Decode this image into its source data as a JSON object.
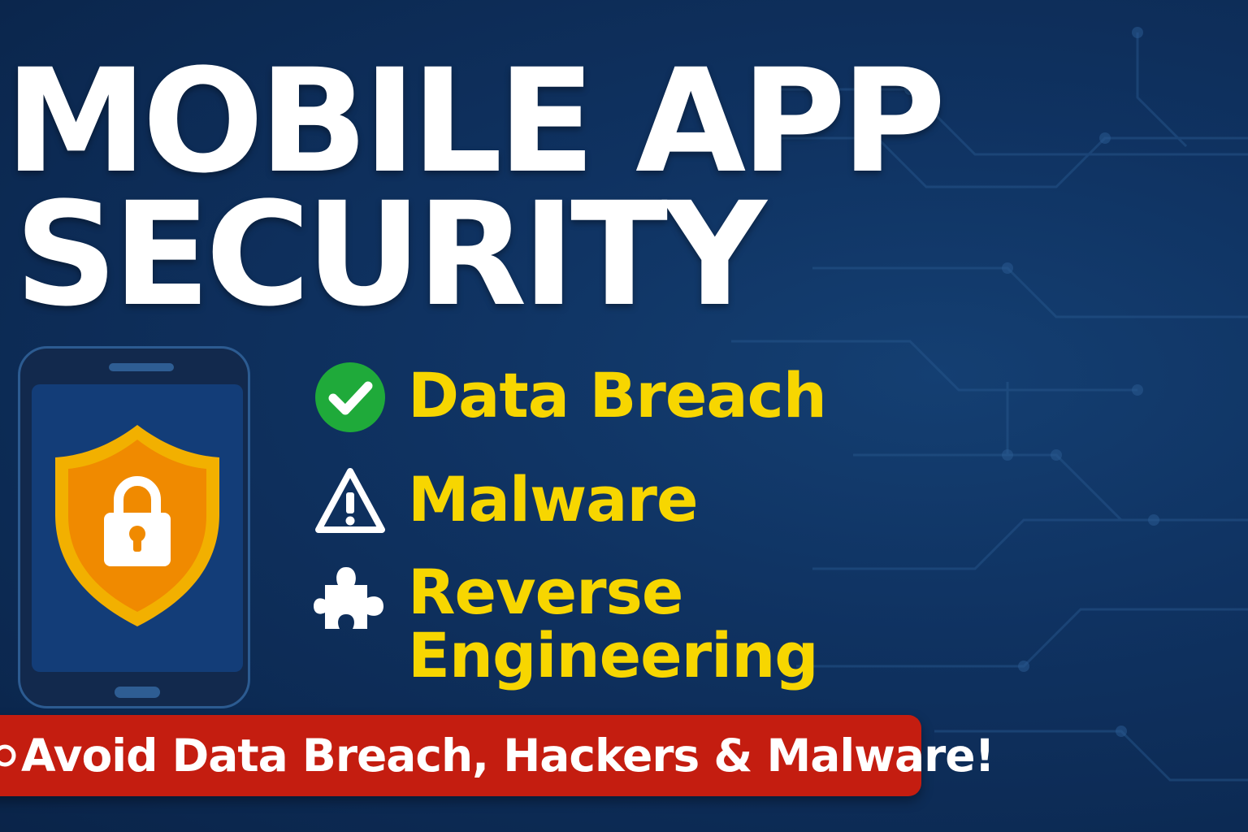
{
  "title": {
    "line1": "MOBILE APP",
    "line2": "SECURITY"
  },
  "features": [
    {
      "icon": "check-circle-icon",
      "label": "Data Breach"
    },
    {
      "icon": "warning-triangle-icon",
      "label": "Malware"
    },
    {
      "icon": "puzzle-piece-icon",
      "label_lines": [
        "Reverse",
        "Engineering"
      ]
    }
  ],
  "banner": {
    "text": "Avoid Data Breach, Hackers & Malware!"
  },
  "illustration": {
    "device": "smartphone",
    "emblem": "shield-lock-icon"
  },
  "colors": {
    "background": "#0f3261",
    "title": "#ffffff",
    "feature_text": "#f7d600",
    "banner": "#c41d10",
    "shield_outer": "#f2b000",
    "shield_inner": "#f08a00",
    "check": "#1faa3a"
  }
}
